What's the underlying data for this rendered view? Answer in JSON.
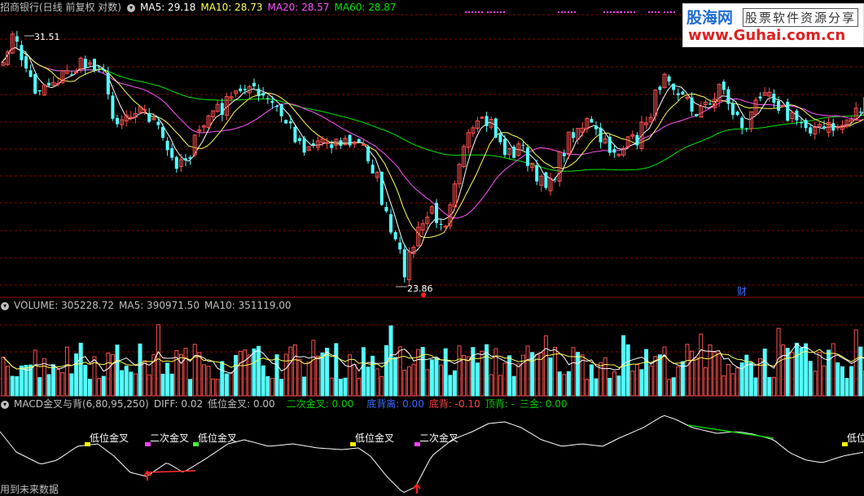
{
  "main_header": {
    "title": "招商银行(日线 前复权 对数)",
    "ma5": "MA5: 29.18",
    "ma10": "MA10: 28.73",
    "ma20": "MA20: 28.57",
    "ma60": "MA60: 28.87"
  },
  "volume_header": {
    "title": "VOLUME: 305228.72",
    "ma5": "MA5: 390971.50",
    "ma10": "MA10: 351119.00"
  },
  "macd_header": {
    "title": "MACD金叉与背(6,80,95,250)",
    "diff": "DIFF: 0.02",
    "low_cross": "低位金叉: 0.00",
    "second_cross": "二次金叉: 0.00",
    "bottom_div": "底背离: 0.00",
    "bottom_back": "底背: -0.10",
    "top_back": "顶背: -",
    "three_gold": "三金: 0.00"
  },
  "annotations": {
    "high_price": "31.51",
    "low_price": "23.86",
    "cai_marker": "财",
    "signal_low_cross": "低位金叉",
    "signal_second_cross": "二次金叉",
    "signal_low_partial": "低位"
  },
  "logo": {
    "main": "股海网",
    "slogan": "股票软件资源分享",
    "url": "www.Guhai.com.cn"
  },
  "footer": "用到未来数据",
  "colors": {
    "up": "#ff5050",
    "down": "#54ffff",
    "ma5": "#ffffff",
    "ma10": "#ffff54",
    "ma20": "#ff54ff",
    "ma60": "#00e600",
    "grid": "#8b0000"
  },
  "chart_data": [
    {
      "type": "candlestick",
      "title": "招商银行(日线 前复权 对数)",
      "price_range": [
        23.86,
        31.51
      ],
      "series": [
        {
          "name": "MA5",
          "last": 29.18
        },
        {
          "name": "MA10",
          "last": 28.73
        },
        {
          "name": "MA20",
          "last": 28.57
        },
        {
          "name": "MA60",
          "last": 28.87
        }
      ],
      "annotations": [
        "31.51",
        "23.86",
        "财"
      ]
    },
    {
      "type": "bar",
      "title": "VOLUME",
      "series": [
        {
          "name": "VOLUME",
          "last": 305228.72
        },
        {
          "name": "MA5",
          "last": 390971.5
        },
        {
          "name": "MA10",
          "last": 351119.0
        }
      ]
    },
    {
      "type": "line",
      "title": "MACD金叉与背(6,80,95,250)",
      "series": [
        {
          "name": "DIFF",
          "last": 0.02
        },
        {
          "name": "低位金叉",
          "last": 0.0
        },
        {
          "name": "二次金叉",
          "last": 0.0
        },
        {
          "name": "底背离",
          "last": 0.0
        },
        {
          "name": "底背",
          "last": -0.1
        },
        {
          "name": "三金",
          "last": 0.0
        }
      ],
      "signals": [
        "低位金叉",
        "二次金叉",
        "低位金叉",
        "低位金叉",
        "二次金叉",
        "低位"
      ]
    }
  ]
}
